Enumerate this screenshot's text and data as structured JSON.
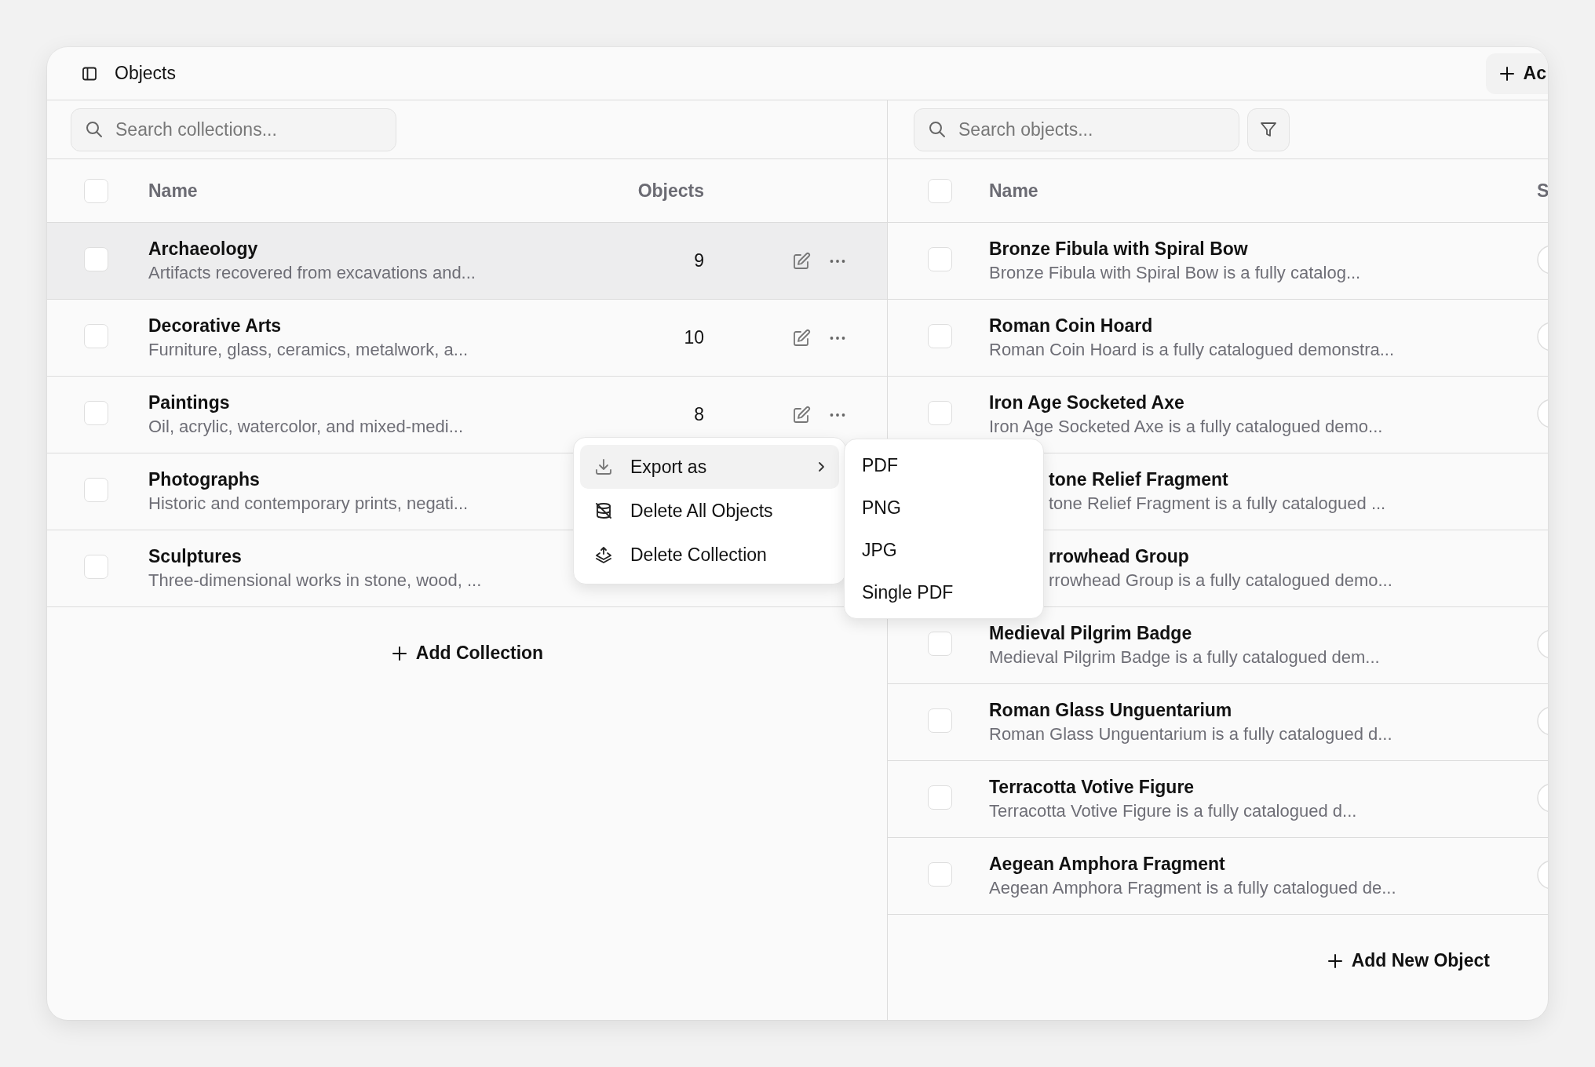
{
  "header": {
    "title": "Objects",
    "add_button": "Ac"
  },
  "collections": {
    "search": {
      "placeholder": "Search collections..."
    },
    "select_all_checked": false,
    "columns": [
      "Name",
      "Objects"
    ],
    "rows": [
      {
        "name": "Archaeology",
        "description": "Artifacts recovered from excavations and...",
        "count": "9",
        "checked": false,
        "highlighted": true,
        "actions": true
      },
      {
        "name": "Decorative Arts",
        "description": "Furniture, glass, ceramics, metalwork, a...",
        "count": "10",
        "checked": false,
        "highlighted": false,
        "actions": true
      },
      {
        "name": "Paintings",
        "description": "Oil, acrylic, watercolor, and mixed-medi...",
        "count": "8",
        "checked": false,
        "highlighted": false,
        "actions": true
      },
      {
        "name": "Photographs",
        "description": "Historic and contemporary prints, negati...",
        "checked": false,
        "highlighted": false
      },
      {
        "name": "Sculptures",
        "description": "Three-dimensional works in stone, wood, ...",
        "checked": false,
        "highlighted": false
      }
    ],
    "add_button": "Add Collection"
  },
  "objects": {
    "search": {
      "placeholder": "Search objects..."
    },
    "select_all_checked": false,
    "columns": [
      "Name",
      "S"
    ],
    "rows": [
      {
        "name": "Bronze Fibula with Spiral Bow",
        "description": "Bronze Fibula with Spiral Bow is a fully catalog...",
        "checked": false,
        "partly_hidden": false
      },
      {
        "name": "Roman Coin Hoard",
        "description": "Roman Coin Hoard is a fully catalogued demonstra...",
        "checked": false,
        "partly_hidden": false
      },
      {
        "name": "Iron Age Socketed Axe",
        "description": "Iron Age Socketed Axe is a fully catalogued demo...",
        "checked": false,
        "partly_hidden": false
      },
      {
        "name": "tone Relief Fragment",
        "description": "tone Relief Fragment is a fully catalogued ...",
        "partly_hidden": true
      },
      {
        "name": "rrowhead Group",
        "description": "rrowhead Group is a fully catalogued demo...",
        "partly_hidden": true
      },
      {
        "name": "Medieval Pilgrim Badge",
        "description": "Medieval Pilgrim Badge is a fully catalogued dem...",
        "checked": false,
        "partly_hidden": false
      },
      {
        "name": "Roman Glass Unguentarium",
        "description": "Roman Glass Unguentarium is a fully catalogued d...",
        "checked": false,
        "partly_hidden": false
      },
      {
        "name": "Terracotta Votive Figure",
        "description": "Terracotta Votive Figure is a fully catalogued d...",
        "checked": false,
        "partly_hidden": false
      },
      {
        "name": "Aegean Amphora Fragment",
        "description": "Aegean Amphora Fragment is a fully catalogued de...",
        "checked": false,
        "partly_hidden": false
      }
    ],
    "add_button": "Add New Object"
  },
  "context_menu": {
    "items": [
      {
        "kind": "export",
        "label": "Export as",
        "highlighted": true,
        "has_submenu": true
      },
      {
        "kind": "delete-objects",
        "label": "Delete All Objects",
        "highlighted": false,
        "has_submenu": false
      },
      {
        "kind": "delete-collection",
        "label": "Delete Collection",
        "highlighted": false,
        "has_submenu": false
      }
    ],
    "submenu": [
      "PDF",
      "PNG",
      "JPG",
      "Single PDF"
    ]
  }
}
